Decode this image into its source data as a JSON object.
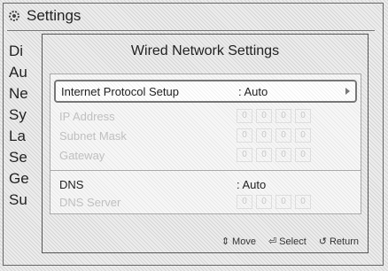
{
  "header": {
    "title": "Settings",
    "icon": "gear-icon"
  },
  "background_menu": [
    "Di",
    "Au",
    "Ne",
    "Sy",
    "La",
    "Se",
    "Ge",
    "Su"
  ],
  "dialog": {
    "title": "Wired Network Settings",
    "rows": [
      {
        "label": "Internet Protocol Setup",
        "value": ": Auto",
        "selected": true
      },
      {
        "label": "IP Address",
        "value": ": ",
        "ip": [
          "0",
          "0",
          "0",
          "0"
        ],
        "disabled": true
      },
      {
        "label": "Subnet Mask",
        "value": ": ",
        "ip": [
          "0",
          "0",
          "0",
          "0"
        ],
        "disabled": true
      },
      {
        "label": "Gateway",
        "value": ": ",
        "ip": [
          "0",
          "0",
          "0",
          "0"
        ],
        "disabled": true
      }
    ],
    "dns_rows": [
      {
        "label": "DNS",
        "value": ": Auto"
      },
      {
        "label": "DNS Server",
        "value": ": ",
        "ip": [
          "0",
          "0",
          "0",
          "0"
        ],
        "disabled": true
      }
    ]
  },
  "footer": {
    "move": "Move",
    "select": "Select",
    "return": "Return"
  }
}
